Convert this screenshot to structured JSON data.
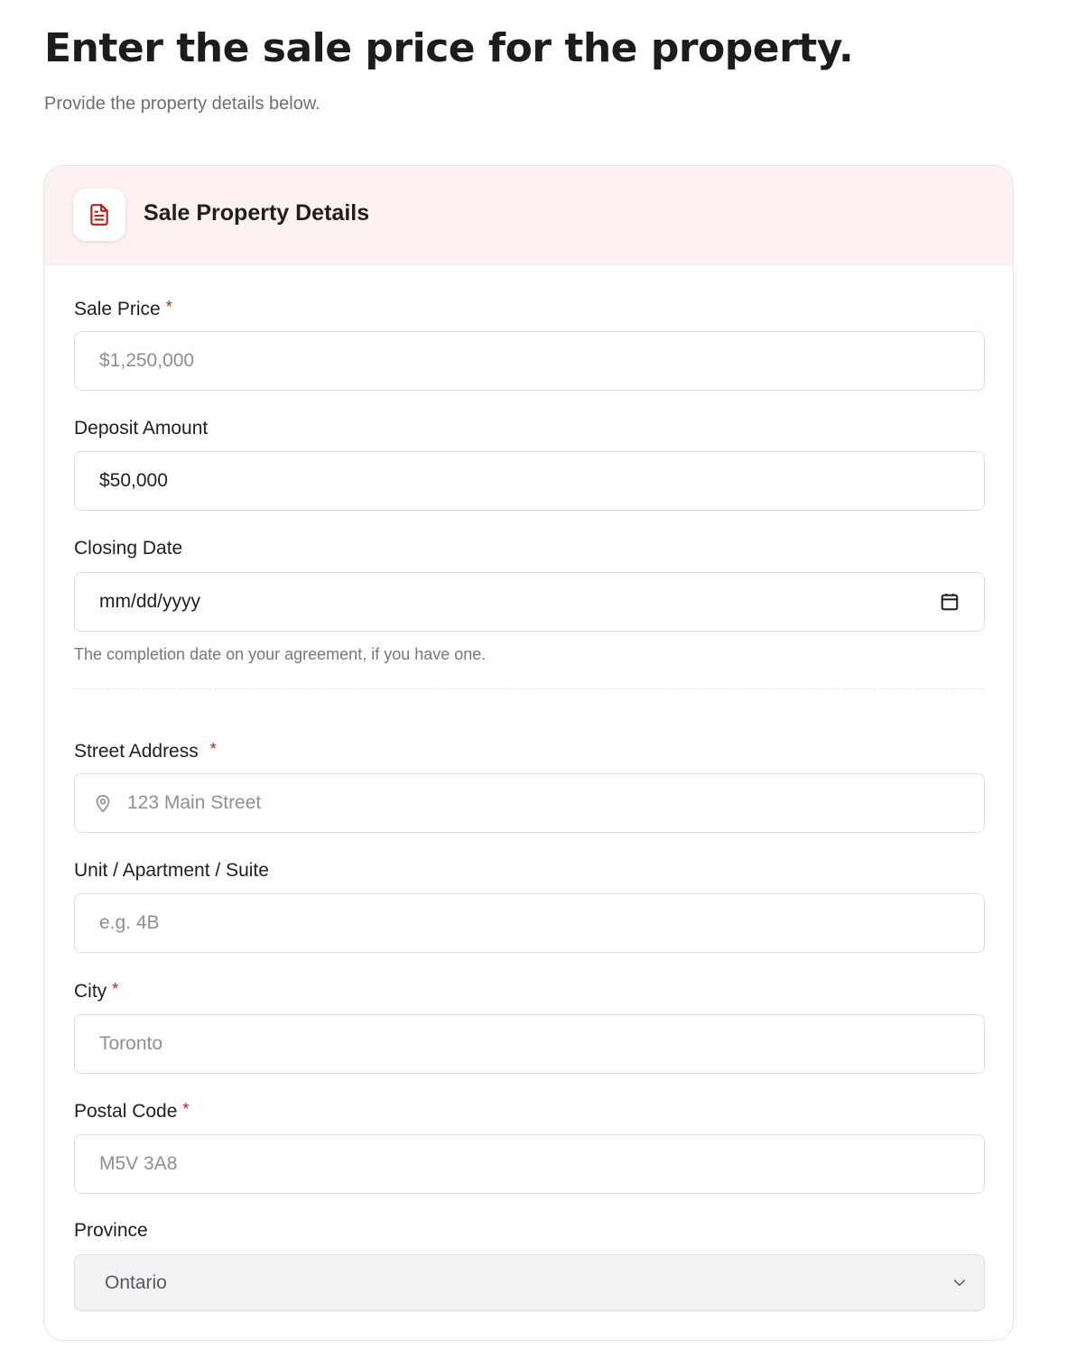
{
  "page": {
    "title": "Enter the sale price for the property.",
    "subtitle": "Provide the property details below."
  },
  "card": {
    "title": "Sale Property Details",
    "icon": "document-icon",
    "accent_color": "#b42318",
    "header_bg": "#fdf1f1"
  },
  "fields": {
    "sale_price": {
      "label": "Sale Price",
      "required_mark": "*",
      "placeholder": "$1,250,000",
      "value": ""
    },
    "deposit_amount": {
      "label": "Deposit Amount",
      "placeholder": "",
      "value": "$50,000"
    },
    "closing_date": {
      "label": "Closing Date",
      "placeholder": "mm/dd/yyyy",
      "helper": "The completion date on your agreement, if you have one.",
      "icon": "calendar-icon"
    },
    "street_address": {
      "label": "Street Address",
      "required_mark": "*",
      "placeholder": "123 Main Street",
      "icon": "map-pin-icon"
    },
    "unit": {
      "label": "Unit / Apartment / Suite",
      "placeholder": "e.g. 4B"
    },
    "city": {
      "label": "City",
      "required_mark": "*",
      "placeholder": "Toronto"
    },
    "postal_code": {
      "label": "Postal Code",
      "required_mark": "*",
      "placeholder": "M5V 3A8"
    },
    "province": {
      "label": "Province",
      "selected": "Ontario",
      "icon": "chevron-down-icon"
    }
  }
}
